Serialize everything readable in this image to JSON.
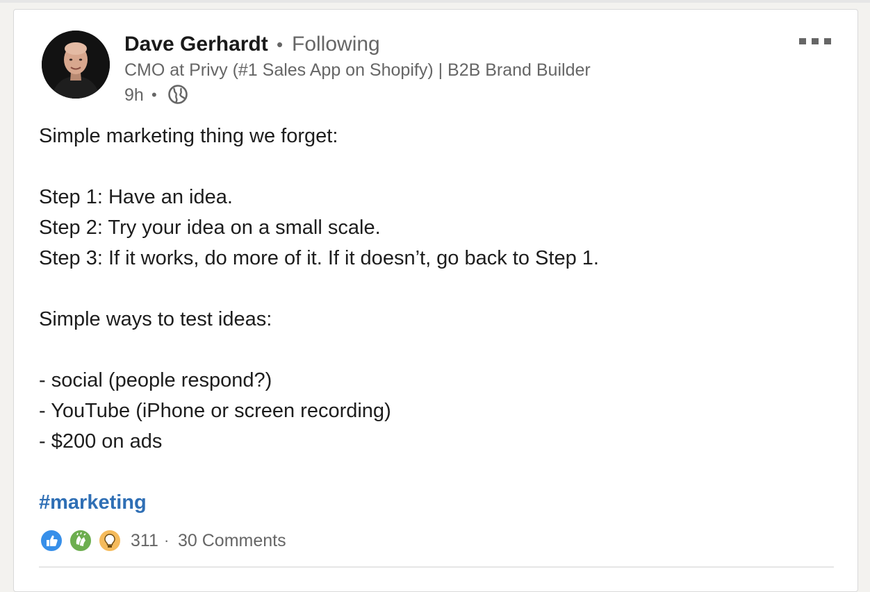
{
  "post": {
    "author": {
      "name": "Dave Gerhardt",
      "separator": "•",
      "follow_status": "Following",
      "headline": "CMO at Privy (#1 Sales App on Shopify) | B2B Brand Builder",
      "timestamp": "9h",
      "timestamp_separator": "•",
      "visibility_icon": "globe-icon"
    },
    "menu_icon": "more-options-icon",
    "body_lines": [
      "Simple marketing thing we forget:",
      "",
      "Step 1: Have an idea.",
      "Step 2: Try your idea on a small scale.",
      "Step 3: If it works, do more of it. If it doesn’t, go back to Step 1.",
      "",
      "Simple ways to test ideas:",
      "",
      "- social (people respond?)",
      "- YouTube (iPhone or screen recording)",
      "- $200 on ads"
    ],
    "hashtag": "#marketing",
    "social": {
      "reactions": [
        {
          "icon": "like-icon",
          "color": "#378fe9"
        },
        {
          "icon": "celebrate-icon",
          "color": "#6dae4f"
        },
        {
          "icon": "insightful-icon",
          "color": "#f5bb5c"
        }
      ],
      "reaction_count": "311",
      "separator": "·",
      "comments": "30 Comments"
    }
  },
  "colors": {
    "link": "#2f6fb5",
    "secondary_text": "#666666",
    "primary_text": "#1d1d1d"
  }
}
